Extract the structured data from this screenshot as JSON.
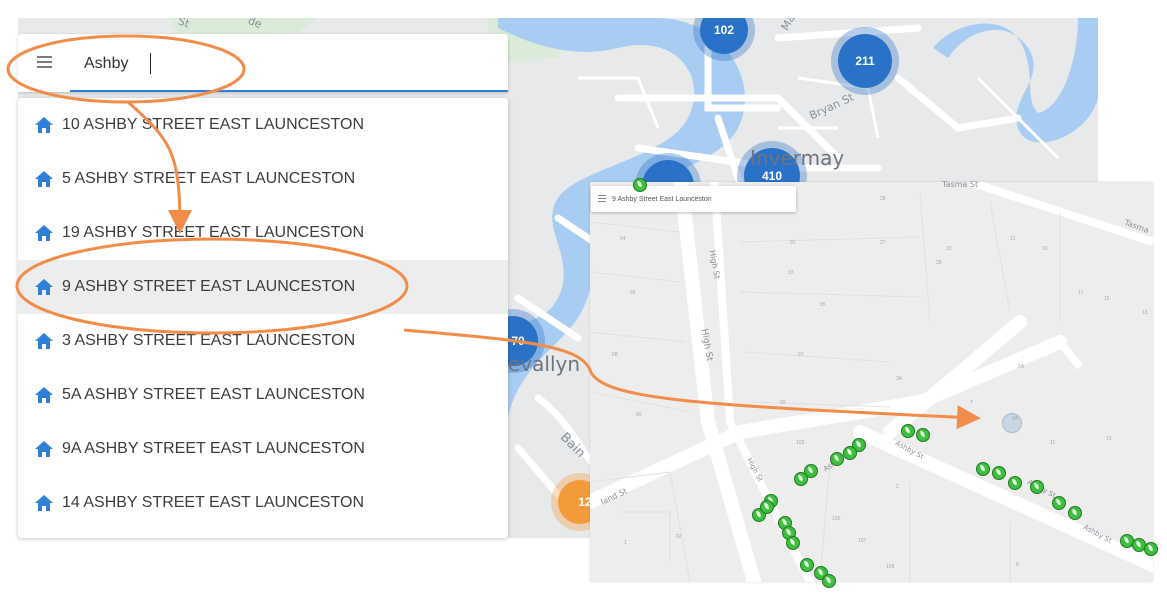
{
  "search": {
    "value": "Ashby",
    "menu_icon": "hamburger-menu-icon"
  },
  "results": [
    {
      "label": "10 ASHBY STREET EAST LAUNCESTON",
      "icon": "home-icon"
    },
    {
      "label": "5 ASHBY STREET EAST LAUNCESTON",
      "icon": "home-icon"
    },
    {
      "label": "19 ASHBY STREET EAST LAUNCESTON",
      "icon": "home-icon"
    },
    {
      "label": "9 ASHBY STREET EAST LAUNCESTON",
      "icon": "home-icon",
      "selected": true
    },
    {
      "label": "3 ASHBY STREET EAST LAUNCESTON",
      "icon": "home-icon"
    },
    {
      "label": "5A ASHBY STREET EAST LAUNCESTON",
      "icon": "home-icon"
    },
    {
      "label": "9A ASHBY STREET EAST LAUNCESTON",
      "icon": "home-icon"
    },
    {
      "label": "14 ASHBY STREET EAST LAUNCESTON",
      "icon": "home-icon"
    }
  ],
  "left_map": {
    "clusters": [
      "102",
      "211",
      "410",
      "70",
      "12"
    ],
    "suburbs": [
      "Invermay",
      "evallyn"
    ],
    "streets": [
      "St",
      "Bryan St",
      "Bain",
      "Ma",
      "de"
    ]
  },
  "right_map": {
    "search_value": "9 Ashby Street East Launceston",
    "streets": [
      "Tasma St",
      "Tasma",
      "High St",
      "High St",
      "High St",
      "Ashby St",
      "Ashby St",
      "Ashby St",
      "Ashby St",
      "land St"
    ],
    "lots": [
      "29",
      "54",
      "91",
      "27",
      "23",
      "21",
      "19",
      "56",
      "93",
      "25",
      "17",
      "95",
      "15",
      "13",
      "97",
      "58",
      "5A",
      "3A",
      "60",
      "99",
      "7",
      "9A",
      "103",
      "11",
      "13",
      "2",
      "105",
      "8",
      "62",
      "107",
      "1",
      "109"
    ]
  },
  "colors": {
    "accent": "#2f7fd8",
    "cluster": "#2a72c8",
    "cluster_orange": "#f39a3b",
    "annotation": "#f28c4a",
    "river": "#a9cdf2",
    "leaf": "#3fbf3f"
  }
}
